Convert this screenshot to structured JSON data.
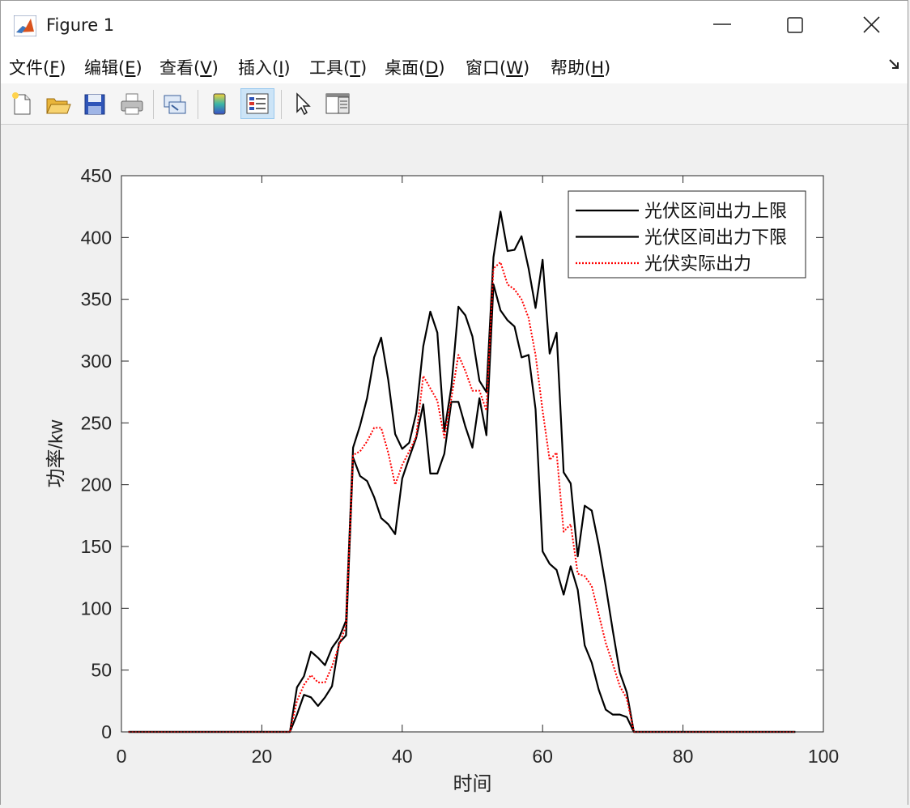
{
  "window": {
    "title": "Figure 1",
    "icon": "matlab-logo-icon"
  },
  "menu": {
    "items": [
      {
        "text": "文件(",
        "key": "F",
        "tail": ")"
      },
      {
        "text": "编辑(",
        "key": "E",
        "tail": ")"
      },
      {
        "text": "查看(",
        "key": "V",
        "tail": ")"
      },
      {
        "text": "插入(",
        "key": "I",
        "tail": ")"
      },
      {
        "text": "工具(",
        "key": "T",
        "tail": ")"
      },
      {
        "text": "桌面(",
        "key": "D",
        "tail": ")"
      },
      {
        "text": "窗口(",
        "key": "W",
        "tail": ")"
      },
      {
        "text": "帮助(",
        "key": "H",
        "tail": ")"
      }
    ]
  },
  "toolbar": {
    "buttons": [
      {
        "icon": "new-file-icon",
        "active": false
      },
      {
        "icon": "open-folder-icon",
        "active": false
      },
      {
        "icon": "save-icon",
        "active": false
      },
      {
        "icon": "print-icon",
        "active": false
      },
      {
        "icon": "link-figure-icon",
        "active": false
      },
      {
        "icon": "colorbar-icon",
        "active": false
      },
      {
        "icon": "legend-icon",
        "active": true
      },
      {
        "icon": "pointer-icon",
        "active": false
      },
      {
        "icon": "property-editor-icon",
        "active": false
      }
    ]
  },
  "chart_data": {
    "type": "line",
    "title": "",
    "xlabel": "时间",
    "ylabel": "功率/kw",
    "xlim": [
      0,
      100
    ],
    "ylim": [
      0,
      450
    ],
    "xticks": [
      0,
      20,
      40,
      60,
      80,
      100
    ],
    "yticks": [
      0,
      50,
      100,
      150,
      200,
      250,
      300,
      350,
      400,
      450
    ],
    "grid": false,
    "legend_position": "top-right",
    "x": [
      1,
      2,
      3,
      4,
      5,
      6,
      7,
      8,
      9,
      10,
      11,
      12,
      13,
      14,
      15,
      16,
      17,
      18,
      19,
      20,
      21,
      22,
      23,
      24,
      25,
      26,
      27,
      28,
      29,
      30,
      31,
      32,
      33,
      34,
      35,
      36,
      37,
      38,
      39,
      40,
      41,
      42,
      43,
      44,
      45,
      46,
      47,
      48,
      49,
      50,
      51,
      52,
      53,
      54,
      55,
      56,
      57,
      58,
      59,
      60,
      61,
      62,
      63,
      64,
      65,
      66,
      67,
      68,
      69,
      70,
      71,
      72,
      73,
      74,
      75,
      76,
      77,
      78,
      79,
      80,
      81,
      82,
      83,
      84,
      85,
      86,
      87,
      88,
      89,
      90,
      91,
      92,
      93,
      94,
      95,
      96
    ],
    "series": [
      {
        "name": "光伏区间出力上限",
        "color": "#000000",
        "style": "solid",
        "values": [
          0,
          0,
          0,
          0,
          0,
          0,
          0,
          0,
          0,
          0,
          0,
          0,
          0,
          0,
          0,
          0,
          0,
          0,
          0,
          0,
          0,
          0,
          0,
          0,
          36,
          45,
          65,
          60,
          54,
          68,
          76,
          90,
          230,
          248,
          270,
          303,
          319,
          285,
          241,
          229,
          234,
          258,
          312,
          340,
          323,
          243,
          279,
          344,
          337,
          320,
          284,
          275,
          384,
          421,
          389,
          390,
          401,
          375,
          343,
          382,
          306,
          323,
          210,
          201,
          142,
          183,
          179,
          151,
          118,
          82,
          48,
          32,
          0,
          0,
          0,
          0,
          0,
          0,
          0,
          0,
          0,
          0,
          0,
          0,
          0,
          0,
          0,
          0,
          0,
          0,
          0,
          0,
          0,
          0,
          0,
          0
        ]
      },
      {
        "name": "光伏区间出力下限",
        "color": "#000000",
        "style": "solid",
        "values": [
          0,
          0,
          0,
          0,
          0,
          0,
          0,
          0,
          0,
          0,
          0,
          0,
          0,
          0,
          0,
          0,
          0,
          0,
          0,
          0,
          0,
          0,
          0,
          0,
          14,
          30,
          28,
          21,
          28,
          37,
          72,
          78,
          222,
          207,
          203,
          190,
          173,
          168,
          160,
          205,
          222,
          238,
          265,
          209,
          209,
          225,
          267,
          267,
          247,
          230,
          270,
          240,
          362,
          341,
          333,
          328,
          303,
          305,
          261,
          146,
          136,
          131,
          111,
          134,
          115,
          70,
          56,
          34,
          18,
          14,
          14,
          12,
          0,
          0,
          0,
          0,
          0,
          0,
          0,
          0,
          0,
          0,
          0,
          0,
          0,
          0,
          0,
          0,
          0,
          0,
          0,
          0,
          0,
          0,
          0,
          0
        ]
      },
      {
        "name": "光伏实际出力",
        "color": "#ff0000",
        "style": "dotted",
        "values": [
          0,
          0,
          0,
          0,
          0,
          0,
          0,
          0,
          0,
          0,
          0,
          0,
          0,
          0,
          0,
          0,
          0,
          0,
          0,
          0,
          0,
          0,
          0,
          0,
          25,
          38,
          46,
          40,
          40,
          53,
          70,
          86,
          224,
          227,
          235,
          246,
          246,
          226,
          200,
          216,
          227,
          239,
          288,
          278,
          268,
          238,
          270,
          305,
          292,
          276,
          276,
          260,
          375,
          380,
          362,
          358,
          350,
          335,
          305,
          260,
          220,
          226,
          162,
          168,
          128,
          126,
          118,
          95,
          72,
          55,
          37,
          27,
          0,
          0,
          0,
          0,
          0,
          0,
          0,
          0,
          0,
          0,
          0,
          0,
          0,
          0,
          0,
          0,
          0,
          0,
          0,
          0,
          0,
          0,
          0,
          0
        ]
      }
    ]
  }
}
